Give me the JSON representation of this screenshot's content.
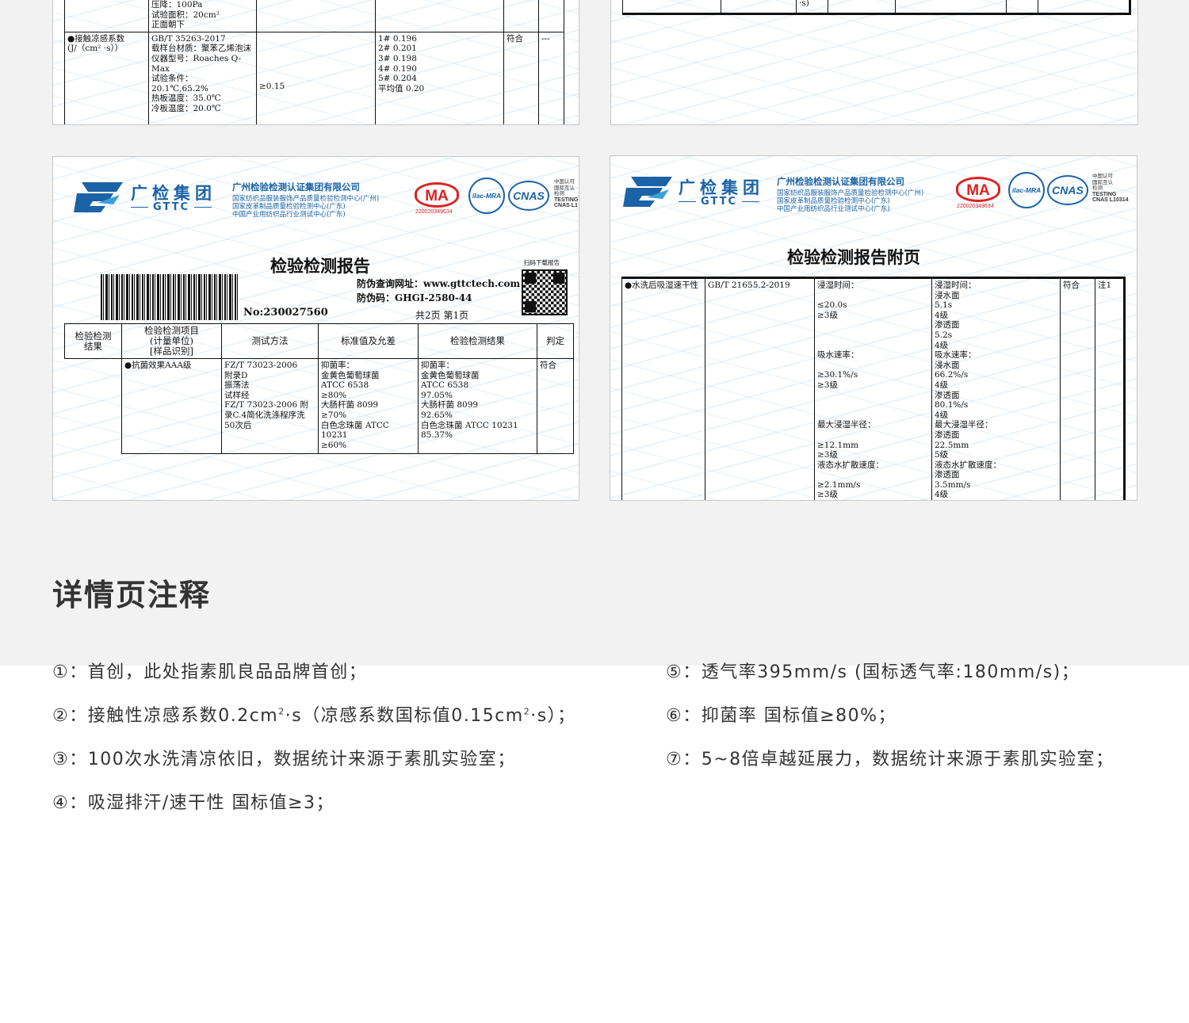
{
  "colors": {
    "brand_blue": "#1b63a6",
    "ma_red": "#d22222",
    "text_dark": "#333333",
    "band_grey": "#f2f2f2"
  },
  "card1": {
    "top_fragment": [
      "压降：100Pa",
      "试验面积：20cm²",
      "正面朝下"
    ],
    "row": {
      "item": "●接触凉感系数\n(J/（cm² ·s））",
      "method": "GB/T 35263-2017\n载样台材质：聚苯乙烯泡沫\n仪器型号：Roaches Q-Max\n试验条件：\n20.1℃,65.2%\n热板温度：35.0℃\n冷板温度：20.0℃",
      "standard": "≥0.15",
      "results": "1#     0.196\n2#     0.201\n3#     0.198\n4#     0.190\n5#     0.204\n平均值  0.20",
      "judge": "符合",
      "remark": "---"
    }
  },
  "card2": {
    "fragment": "·s)"
  },
  "header": {
    "brand_cn": "广检集团",
    "brand_en": "GTTC",
    "company": "广州检验检测认证集团有限公司",
    "centers": [
      "国家纺织品服装服饰产品质量检验检测中心(广州)",
      "国家皮革制品质量检验检测中心(广东)",
      "中国产业用纺织品行业测试中心(广东)"
    ],
    "ma": "MA",
    "ma_no": "220020349634",
    "ilac": "ilac-MRA",
    "cnas": "CNAS",
    "cnas_side": [
      "中国认可",
      "国际互认",
      "检测",
      "TESTING"
    ],
    "cnas_no": "CNAS L10314",
    "cnas_no_short": "CNAS L1"
  },
  "card3": {
    "title": "检验检测报告",
    "qr_caption": "扫码下载报告",
    "anti_fake_url": "防伪查询网址：www.gttctech.com",
    "anti_fake_code": "防伪码：GHGI-2580-44",
    "report_no": "No:230027560",
    "pages": "共2页  第1页",
    "headers": [
      "检验检测\n结果",
      "检验检测项目\n(计量单位)\n[样品识别]",
      "测试方法",
      "标准值及允差",
      "检验检测结果",
      "判定"
    ],
    "row": {
      "item": "●抗菌效果AAA级",
      "method": "FZ/T 73023-2006\n附录D\n振荡法\n试样经\nFZ/T 73023-2006 附录C.4简化洗涤程序洗50次后",
      "standard": "抑菌率：\n金黄色葡萄球菌\nATCC 6538\n≥80%\n大肠杆菌 8099\n≥70%\n白色念珠菌 ATCC 10231\n≥60%",
      "result": "抑菌率：\n金黄色葡萄球菌\nATCC 6538\n97.05%\n大肠杆菌 8099\n92.65%\n白色念珠菌 ATCC 10231\n85.37%",
      "judge": "符合"
    }
  },
  "card4": {
    "title": "检验检测报告附页",
    "row": {
      "item": "●水洗后吸湿速干性",
      "method": "GB/T 21655.2-2019",
      "standard": "浸湿时间：\n\n≤20.0s\n≥3级\n\n\n\n吸水速率：\n\n≥30.1%/s\n≥3级\n\n\n\n最大浸湿半径：\n\n≥12.1mm\n≥3级\n液态水扩散速度：\n\n≥2.1mm/s\n≥3级",
      "result": "浸湿时间：\n浸水面\n5.1s\n4级\n渗透面\n5.2s\n4级\n吸水速率：\n浸水面\n66.2%/s\n4级\n渗透面\n80.1%/s\n4级\n最大浸湿半径：\n渗透面\n22.5mm\n5级\n液态水扩散速度：\n渗透面\n3.5mm/s\n4级",
      "judge": "符合",
      "remark": "注1"
    }
  },
  "section_title": "详情页注释",
  "notes_left": [
    {
      "prefix": "①：首创，此处指素肌良品品牌首创；"
    },
    {
      "prefix": "②：接触性凉感系数0.2cm",
      "sup1": "2",
      "mid": "·s（凉感系数国标值0.15cm",
      "sup2": "2",
      "suffix": "·s）；"
    },
    {
      "prefix": "③：100次水洗清凉依旧，数据统计来源于素肌实验室；"
    },
    {
      "prefix": "④：吸湿排汗/速干性 国标值≥3；"
    }
  ],
  "notes_right": [
    "⑤：透气率395mm/s (国标透气率:180mm/s)；",
    "⑥：抑菌率 国标值≥80%；",
    "⑦：5~8倍卓越延展力，数据统计来源于素肌实验室；"
  ]
}
